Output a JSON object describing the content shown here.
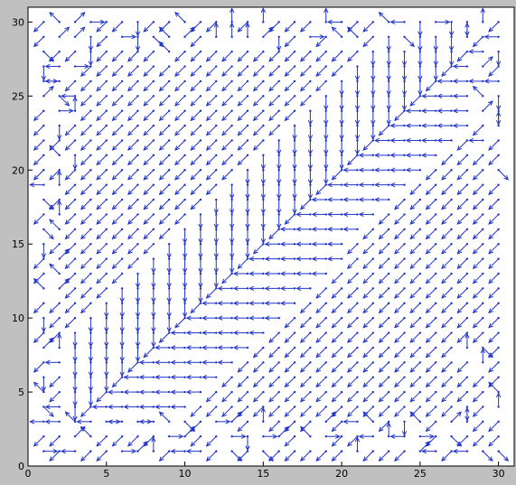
{
  "chart_data": {
    "type": "quiver",
    "title": "",
    "xlabel": "",
    "ylabel": "",
    "xlim": [
      0,
      31
    ],
    "ylim": [
      0,
      31
    ],
    "xticks": [
      0,
      5,
      10,
      15,
      20,
      25,
      30
    ],
    "yticks": [
      0,
      5,
      10,
      15,
      20,
      25,
      30
    ],
    "grid": false,
    "arrow_color": "#1f32c8",
    "background": "#c0c0c0",
    "plot_background": "#ffffff",
    "grid_extent": [
      1,
      30
    ],
    "grid_step": 1,
    "field_description_regions": [
      {
        "region": "x > y + 1 (lower-right triangle)",
        "direction": "south-west diagonal (-1,-1)"
      },
      {
        "region": "y > x + 1 (upper-left triangle)",
        "direction": "south-west diagonal (-1,-1)"
      },
      {
        "region": "band just below the diagonal",
        "direction": "west (-1,0)"
      },
      {
        "region": "band just above the diagonal",
        "direction": "south (0,-1)"
      },
      {
        "region": "border noise near edges",
        "direction": "mixed"
      }
    ]
  }
}
